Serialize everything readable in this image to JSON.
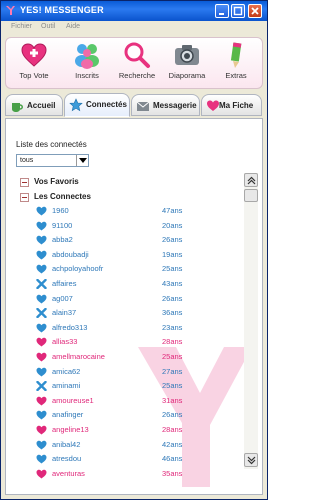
{
  "window": {
    "title": "YES! MESSENGER"
  },
  "menu": [
    "Fichier",
    "Outil",
    "Aide"
  ],
  "toolbar": [
    {
      "label": "Top Vote",
      "icon": "heart-icon"
    },
    {
      "label": "Inscrits",
      "icon": "users-icon"
    },
    {
      "label": "Recherche",
      "icon": "magnifier-icon"
    },
    {
      "label": "Diaporama",
      "icon": "camera-icon"
    },
    {
      "label": "Extras",
      "icon": "pencil-icon"
    }
  ],
  "tabs": [
    {
      "label": "Accueil",
      "icon": "cup-icon",
      "active": false
    },
    {
      "label": "Connectés",
      "icon": "star-icon",
      "active": true
    },
    {
      "label": "Messagerie",
      "icon": "envelope-icon",
      "active": false
    },
    {
      "label": "Ma Fiche",
      "icon": "heart-icon",
      "active": false
    }
  ],
  "panel": {
    "heading": "Liste des connectés",
    "filter": {
      "selected": "tous"
    }
  },
  "groups": {
    "favorites": "Vos Favoris",
    "connected": "Les Connectes"
  },
  "users": [
    {
      "name": "1960",
      "age": "47ans",
      "gender": "m"
    },
    {
      "name": "91100",
      "age": "20ans",
      "gender": "m"
    },
    {
      "name": "abba2",
      "age": "26ans",
      "gender": "m"
    },
    {
      "name": "abdoubadji",
      "age": "19ans",
      "gender": "m"
    },
    {
      "name": "achpoloyahoofr",
      "age": "25ans",
      "gender": "m"
    },
    {
      "name": "affaires",
      "age": "43ans",
      "gender": "mx"
    },
    {
      "name": "ag007",
      "age": "26ans",
      "gender": "m"
    },
    {
      "name": "alain37",
      "age": "36ans",
      "gender": "mx"
    },
    {
      "name": "alfredo313",
      "age": "23ans",
      "gender": "m"
    },
    {
      "name": "allias33",
      "age": "28ans",
      "gender": "f"
    },
    {
      "name": "amellmarocaine",
      "age": "25ans",
      "gender": "f"
    },
    {
      "name": "amica62",
      "age": "27ans",
      "gender": "m"
    },
    {
      "name": "aminami",
      "age": "25ans",
      "gender": "mx"
    },
    {
      "name": "amoureuse1",
      "age": "31ans",
      "gender": "f"
    },
    {
      "name": "anafinger",
      "age": "26ans",
      "gender": "m"
    },
    {
      "name": "angeline13",
      "age": "28ans",
      "gender": "f"
    },
    {
      "name": "anibal42",
      "age": "42ans",
      "gender": "m"
    },
    {
      "name": "atresdou",
      "age": "46ans",
      "gender": "m"
    },
    {
      "name": "aventuras",
      "age": "35ans",
      "gender": "f"
    }
  ],
  "colors": {
    "male": "#2e78b8",
    "female": "#e0287a",
    "accent": "#e64a8f"
  }
}
